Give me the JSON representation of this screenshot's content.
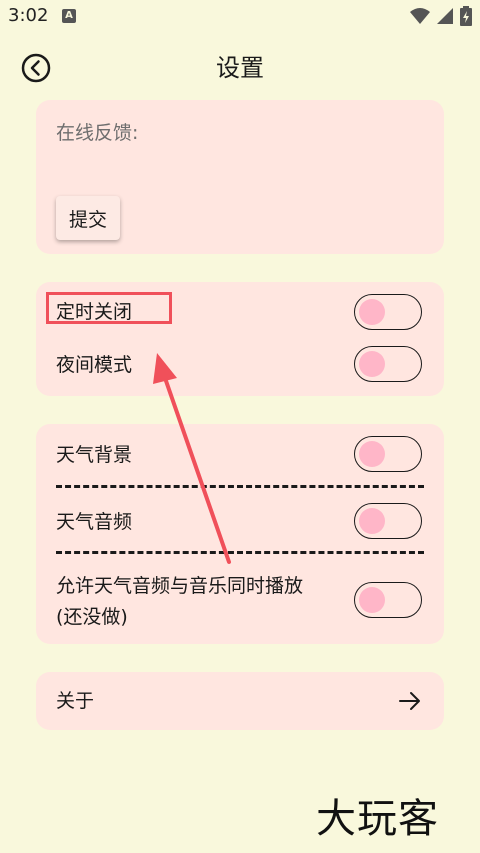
{
  "status_bar": {
    "time": "3:02",
    "notification_letter": "A"
  },
  "header": {
    "title": "设置"
  },
  "feedback": {
    "label": "在线反馈:",
    "input_value": "",
    "submit_label": "提交"
  },
  "timer_section": {
    "items": [
      {
        "label": "定时关闭",
        "on": false
      },
      {
        "label": "夜间模式",
        "on": false
      }
    ]
  },
  "weather_section": {
    "items": [
      {
        "label": "天气背景",
        "on": false
      },
      {
        "label": "天气音频",
        "on": false
      },
      {
        "label_line1": "允许天气音频与音乐同时播放",
        "label_line2": "(还没做)",
        "on": false
      }
    ]
  },
  "about": {
    "label": "关于"
  },
  "colors": {
    "background": "#f9f8dc",
    "card": "#ffe6e0",
    "toggle_knob": "#ffb6c8",
    "annotation_red": "#f0505a"
  },
  "watermark": "大玩客"
}
